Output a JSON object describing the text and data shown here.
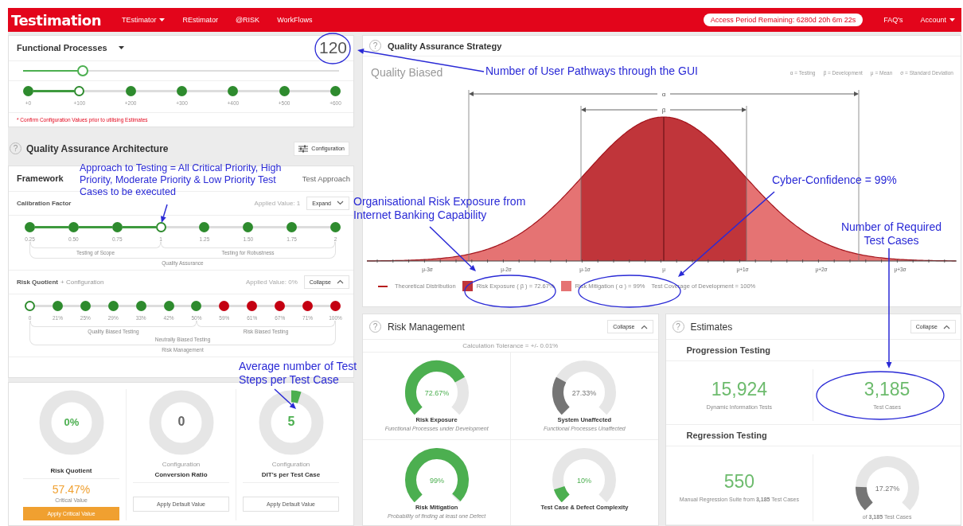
{
  "nav": {
    "logo": "Testimation",
    "items": [
      {
        "label": "TEstimator",
        "dropdown": true
      },
      {
        "label": "REstimator",
        "dropdown": false
      },
      {
        "label": "@RISK",
        "dropdown": false
      },
      {
        "label": "WorkFlows",
        "dropdown": false
      }
    ],
    "access": "Access Period Remaining: 6280d 20h 6m 22s",
    "right_items": [
      {
        "label": "FAQ's",
        "dropdown": false
      },
      {
        "label": "Account",
        "dropdown": true
      }
    ]
  },
  "functional_processes": {
    "title": "Functional Processes",
    "value": "120",
    "slider": {
      "level": 0.19
    },
    "steps": [
      {
        "label": "+0",
        "selected": false
      },
      {
        "label": "+100",
        "selected": true
      },
      {
        "label": "+200",
        "selected": false
      },
      {
        "label": "+300",
        "selected": false
      },
      {
        "label": "+400",
        "selected": false
      },
      {
        "label": "+500",
        "selected": false
      },
      {
        "label": "+600",
        "selected": false
      }
    ],
    "note": "* Confirm Configuration Values prior to utilising Estimates"
  },
  "architecture": {
    "help": "?",
    "title": "Quality Assurance Architecture",
    "config_button": "Configuration",
    "framework": "Framework",
    "approach": "Test Approach",
    "calibration": {
      "title": "Calibration Factor",
      "applied": "Applied Value: 1",
      "toggle": {
        "label": "Expand",
        "expanded": false
      },
      "steps": [
        {
          "label": "0.25",
          "selected": false
        },
        {
          "label": "0.50",
          "selected": false
        },
        {
          "label": "0.75",
          "selected": false
        },
        {
          "label": "1",
          "selected": true
        },
        {
          "label": "1.25",
          "selected": false
        },
        {
          "label": "1.50",
          "selected": false
        },
        {
          "label": "1.75",
          "selected": false
        },
        {
          "label": "2",
          "selected": false
        }
      ],
      "groups": [
        {
          "label": "Testing of Scope",
          "kind": "inner"
        },
        {
          "label": "Testing for Robustness",
          "kind": "inner"
        },
        {
          "label": "Quality Assurance",
          "kind": "outer"
        }
      ]
    },
    "risk": {
      "title": "Risk Quotient",
      "subtitle": "+ Configuration",
      "applied": "Applied Value: 0%",
      "toggle": {
        "label": "Collapse",
        "expanded": true
      },
      "steps": [
        {
          "label": "0",
          "selected": true,
          "color": "#2e8b2e"
        },
        {
          "label": "21%",
          "selected": false,
          "color": "#2e8b2e"
        },
        {
          "label": "25%",
          "selected": false,
          "color": "#2e8b2e"
        },
        {
          "label": "29%",
          "selected": false,
          "color": "#2e8b2e"
        },
        {
          "label": "33%",
          "selected": false,
          "color": "#2e8b2e"
        },
        {
          "label": "42%",
          "selected": false,
          "color": "#2e8b2e"
        },
        {
          "label": "50%",
          "selected": false,
          "color": "#2e8b2e"
        },
        {
          "label": "59%",
          "selected": false,
          "color": "#c40012"
        },
        {
          "label": "61%",
          "selected": false,
          "color": "#c40012"
        },
        {
          "label": "67%",
          "selected": false,
          "color": "#c40012"
        },
        {
          "label": "71%",
          "selected": false,
          "color": "#c40012"
        },
        {
          "label": "100%",
          "selected": false,
          "color": "#c40012"
        }
      ],
      "groups": [
        {
          "label": "Quality Biased Testing",
          "kind": "inner"
        },
        {
          "label": "Risk Biased Testing",
          "kind": "inner"
        },
        {
          "label": "Neutrally Biased Testing",
          "kind": "middle"
        },
        {
          "label": "Risk Management",
          "kind": "outer"
        }
      ]
    }
  },
  "gauges": [
    {
      "value": "0%",
      "color": "#4caf50",
      "caption": "Risk Quotient",
      "extra": "57.47%",
      "extra_label": "Critical Value",
      "button": {
        "label": "Apply Critical Value",
        "kind": "primary"
      }
    },
    {
      "value": "0",
      "color": "#666666",
      "overline": "Configuration",
      "caption": "Conversion Ratio",
      "button": {
        "label": "Apply Default Value",
        "kind": "default"
      }
    },
    {
      "value": "5",
      "color": "#4caf50",
      "overline": "Configuration",
      "caption": "DIT's per Test Case",
      "button": {
        "label": "Apply Default Value",
        "kind": "default"
      }
    }
  ],
  "strategy": {
    "help": "?",
    "title": "Quality Assurance Strategy",
    "subtitle": "Quality Biased",
    "legend_top": [
      "α = Testing",
      "β = Development",
      "μ = Mean",
      "σ = Standard Deviation"
    ],
    "chart": {
      "outer_label": "α",
      "inner_label": "β",
      "ticks": [
        "μ-3σ",
        "μ-2σ",
        "μ-1σ",
        "μ",
        "μ+1σ",
        "μ+2σ",
        "μ+3σ"
      ]
    },
    "legend": [
      {
        "label": "Theoretical Distribution",
        "kind": "line"
      },
      {
        "label": "Risk Exposure ( β ) = 72.67%",
        "kind": "swatch",
        "color": "#c0353a"
      },
      {
        "label": "Risk Mitigation ( α ) = 99%",
        "kind": "swatch",
        "color": "#e57373"
      },
      {
        "label": "Test Coverage of Development = 100%",
        "kind": "text"
      }
    ]
  },
  "risk_management": {
    "help": "?",
    "title": "Risk Management",
    "toggle": {
      "label": "Collapse",
      "expanded": true
    },
    "tolerance": "Calculation Tolerance = +/- 0.01%",
    "gauges": [
      {
        "value": "72.67%",
        "color": "#4caf50",
        "title": "Risk Exposure",
        "subtitle": "Functional Processes under Development"
      },
      {
        "value": "27.33%",
        "color": "#757575",
        "title": "System Unaffected",
        "subtitle": "Functional Processes Unaffected"
      },
      {
        "value": "99%",
        "color": "#4caf50",
        "title": "Risk Mitigation",
        "subtitle": "Probability of finding at least one Defect"
      },
      {
        "value": "10%",
        "color": "#4caf50",
        "title": "Test Case & Defect Complexity"
      }
    ]
  },
  "estimates": {
    "help": "?",
    "title": "Estimates",
    "toggle": {
      "label": "Collapse",
      "expanded": true
    },
    "sections": [
      {
        "title": "Progression Testing",
        "cells": [
          {
            "kind": "number",
            "value": "15,924",
            "label": "Dynamic Information Tests"
          },
          {
            "kind": "number",
            "value": "3,185",
            "label": "Test Cases"
          }
        ]
      },
      {
        "title": "Regression Testing",
        "cells": [
          {
            "kind": "number",
            "value": "550",
            "label": "Manual Regression Suite from **3,185** Test Cases"
          },
          {
            "kind": "gauge",
            "value": "17.27%",
            "color": "#757575",
            "label": "of **3,185** Test Cases"
          }
        ]
      }
    ]
  },
  "annotations": [
    {
      "text": "Number of User Pathways through the GUI"
    },
    {
      "text": "Approach to Testing = All Critical Priority, High Priority, Moderate Priority & Low Priority Test Cases to be executed"
    },
    {
      "text": "Organisational Risk Exposure from Internet Banking Capability"
    },
    {
      "text": "Cyber-Confidence = 99%"
    },
    {
      "text": "Number of Required Test Cases"
    },
    {
      "text": "Average number of Test Steps per Test Case"
    }
  ]
}
